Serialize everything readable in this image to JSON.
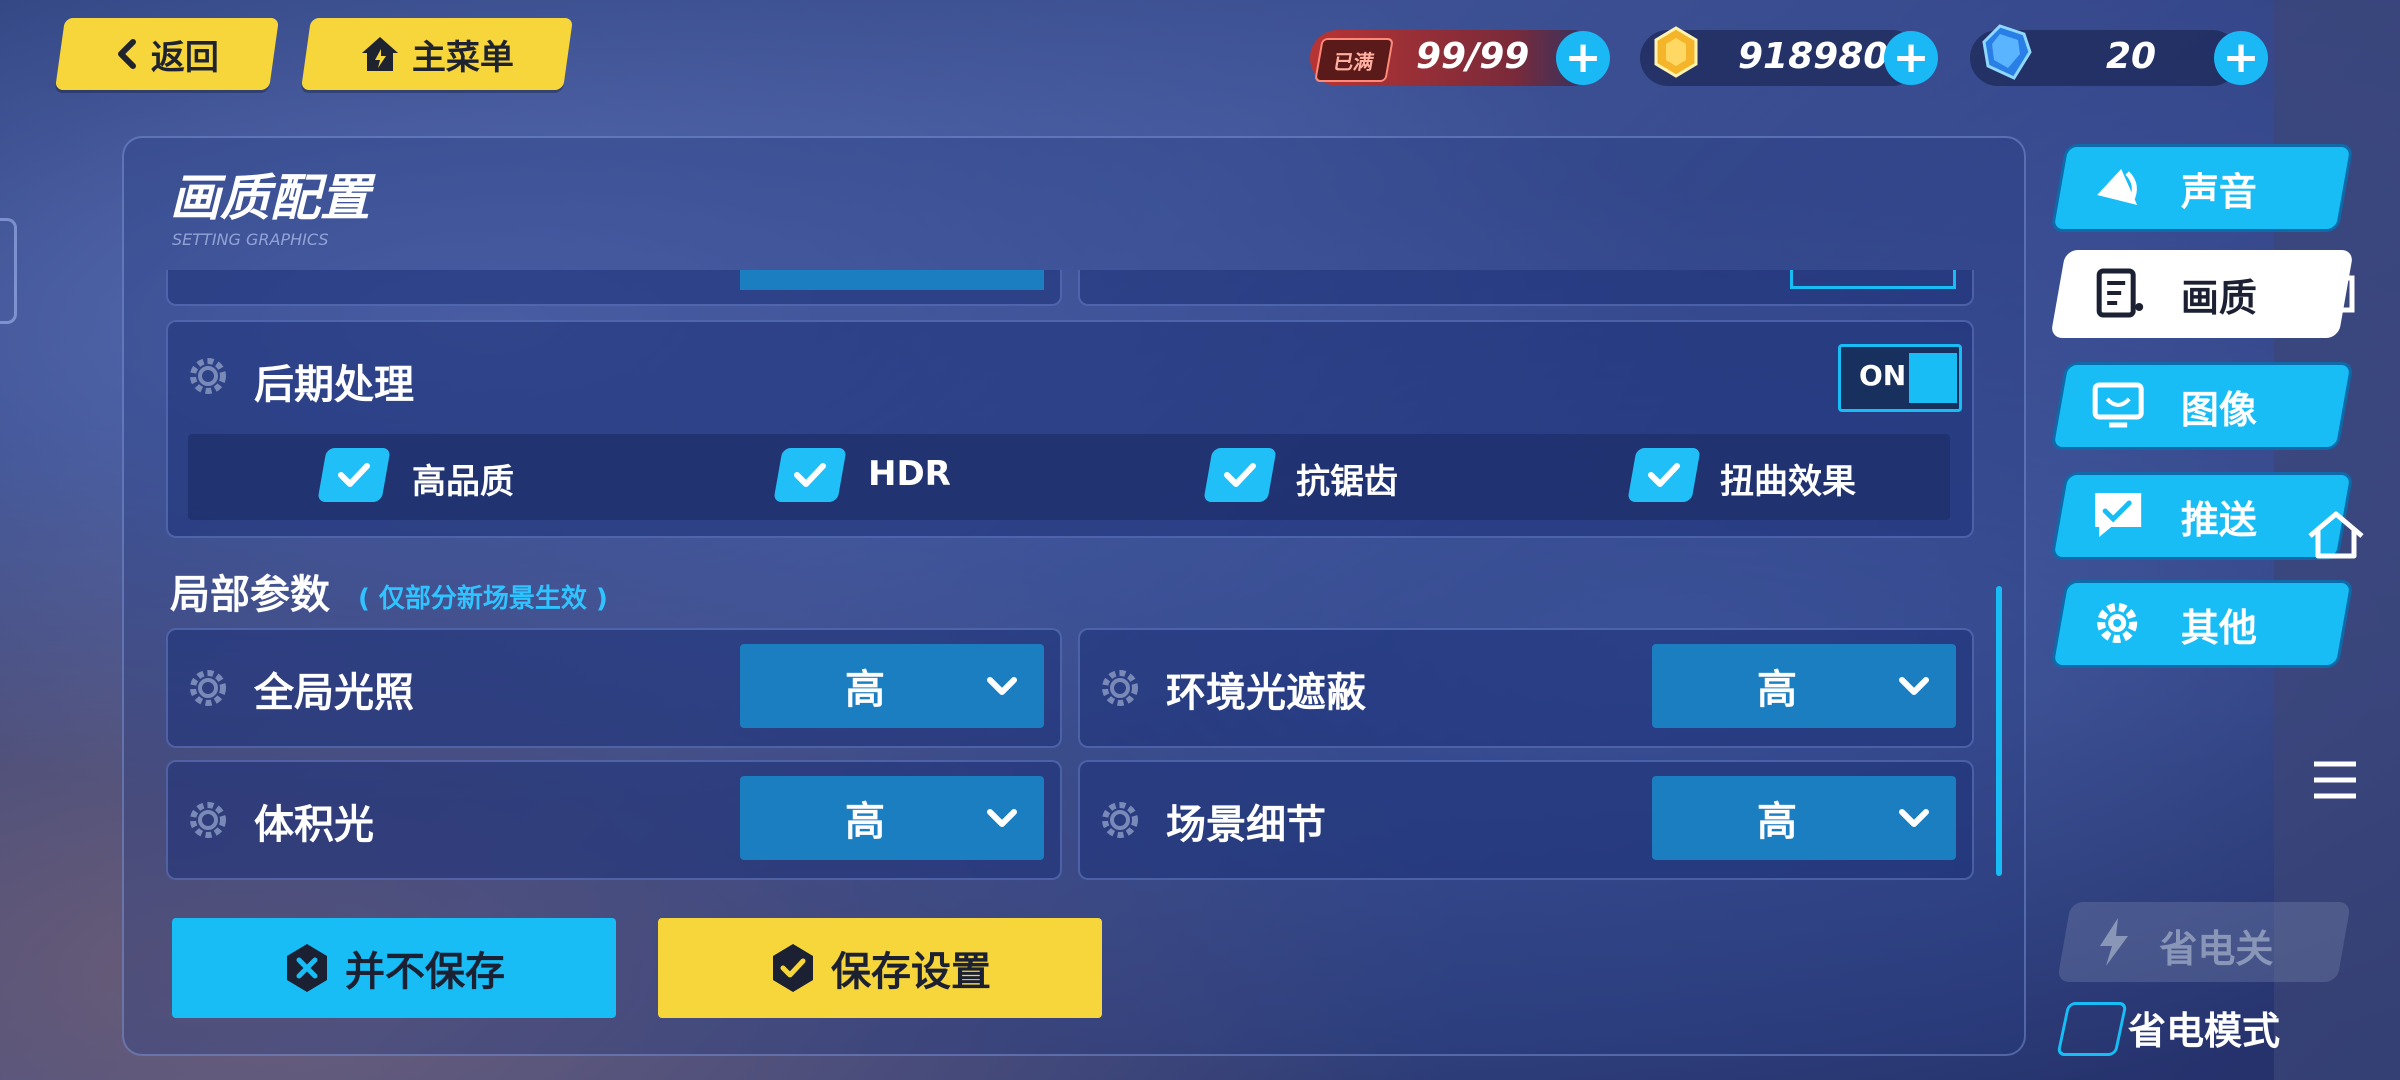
{
  "top": {
    "back_label": "返回",
    "menu_label": "主菜单"
  },
  "currency": {
    "stamina_badge": "已满",
    "stamina": "99/99",
    "coins": "918980",
    "crystals": "20"
  },
  "panel": {
    "title": "画质配置",
    "subtitle": "SETTING GRAPHICS",
    "post": {
      "label": "后期处理",
      "toggle": "ON",
      "options": [
        {
          "label": "高品质",
          "checked": true
        },
        {
          "label": "HDR",
          "checked": true
        },
        {
          "label": "抗锯齿",
          "checked": true
        },
        {
          "label": "扭曲效果",
          "checked": true
        }
      ]
    },
    "local": {
      "title": "局部参数",
      "note": "( 仅部分新场景生效 )",
      "items": [
        {
          "label": "全局光照",
          "value": "高"
        },
        {
          "label": "环境光遮蔽",
          "value": "高"
        },
        {
          "label": "体积光",
          "value": "高"
        },
        {
          "label": "场景细节",
          "value": "高"
        }
      ]
    },
    "buttons": {
      "discard": "并不保存",
      "save": "保存设置"
    }
  },
  "tabs": [
    {
      "label": "声音",
      "active": false
    },
    {
      "label": "画质",
      "active": true
    },
    {
      "label": "图像",
      "active": false
    },
    {
      "label": "推送",
      "active": false
    },
    {
      "label": "其他",
      "active": false
    }
  ],
  "power": {
    "button": "省电关",
    "mode_label": "省电模式"
  },
  "colors": {
    "accent_blue": "#19bdf6",
    "accent_yellow": "#f6d63a",
    "dropdown": "#1a7ec1"
  }
}
